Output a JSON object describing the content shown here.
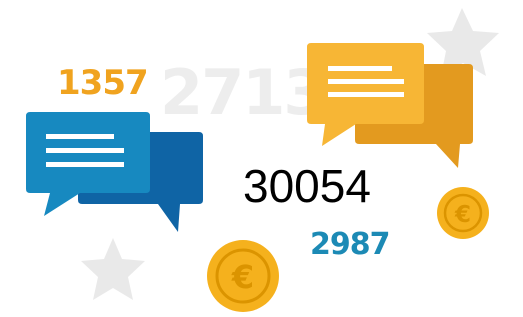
{
  "numbers": {
    "orange": "1357",
    "gray": "2713",
    "blue": "2987",
    "center": "30054"
  },
  "icons": {
    "coin_symbol": "€",
    "star": "star-icon",
    "chat": "chat-bubble-icon"
  },
  "colors": {
    "orange_text": "#f0a31f",
    "gray_text": "#ededed",
    "blue_text": "#1c8ab5",
    "center_text": "#000000",
    "blue_light": "#1789c0",
    "blue_dark": "#0f64a5",
    "yellow_light": "#f7b635",
    "yellow_dark": "#e39a1f",
    "coin": "#f5b11d",
    "coin_dark": "#db9400",
    "star": "#e9e9e9"
  }
}
